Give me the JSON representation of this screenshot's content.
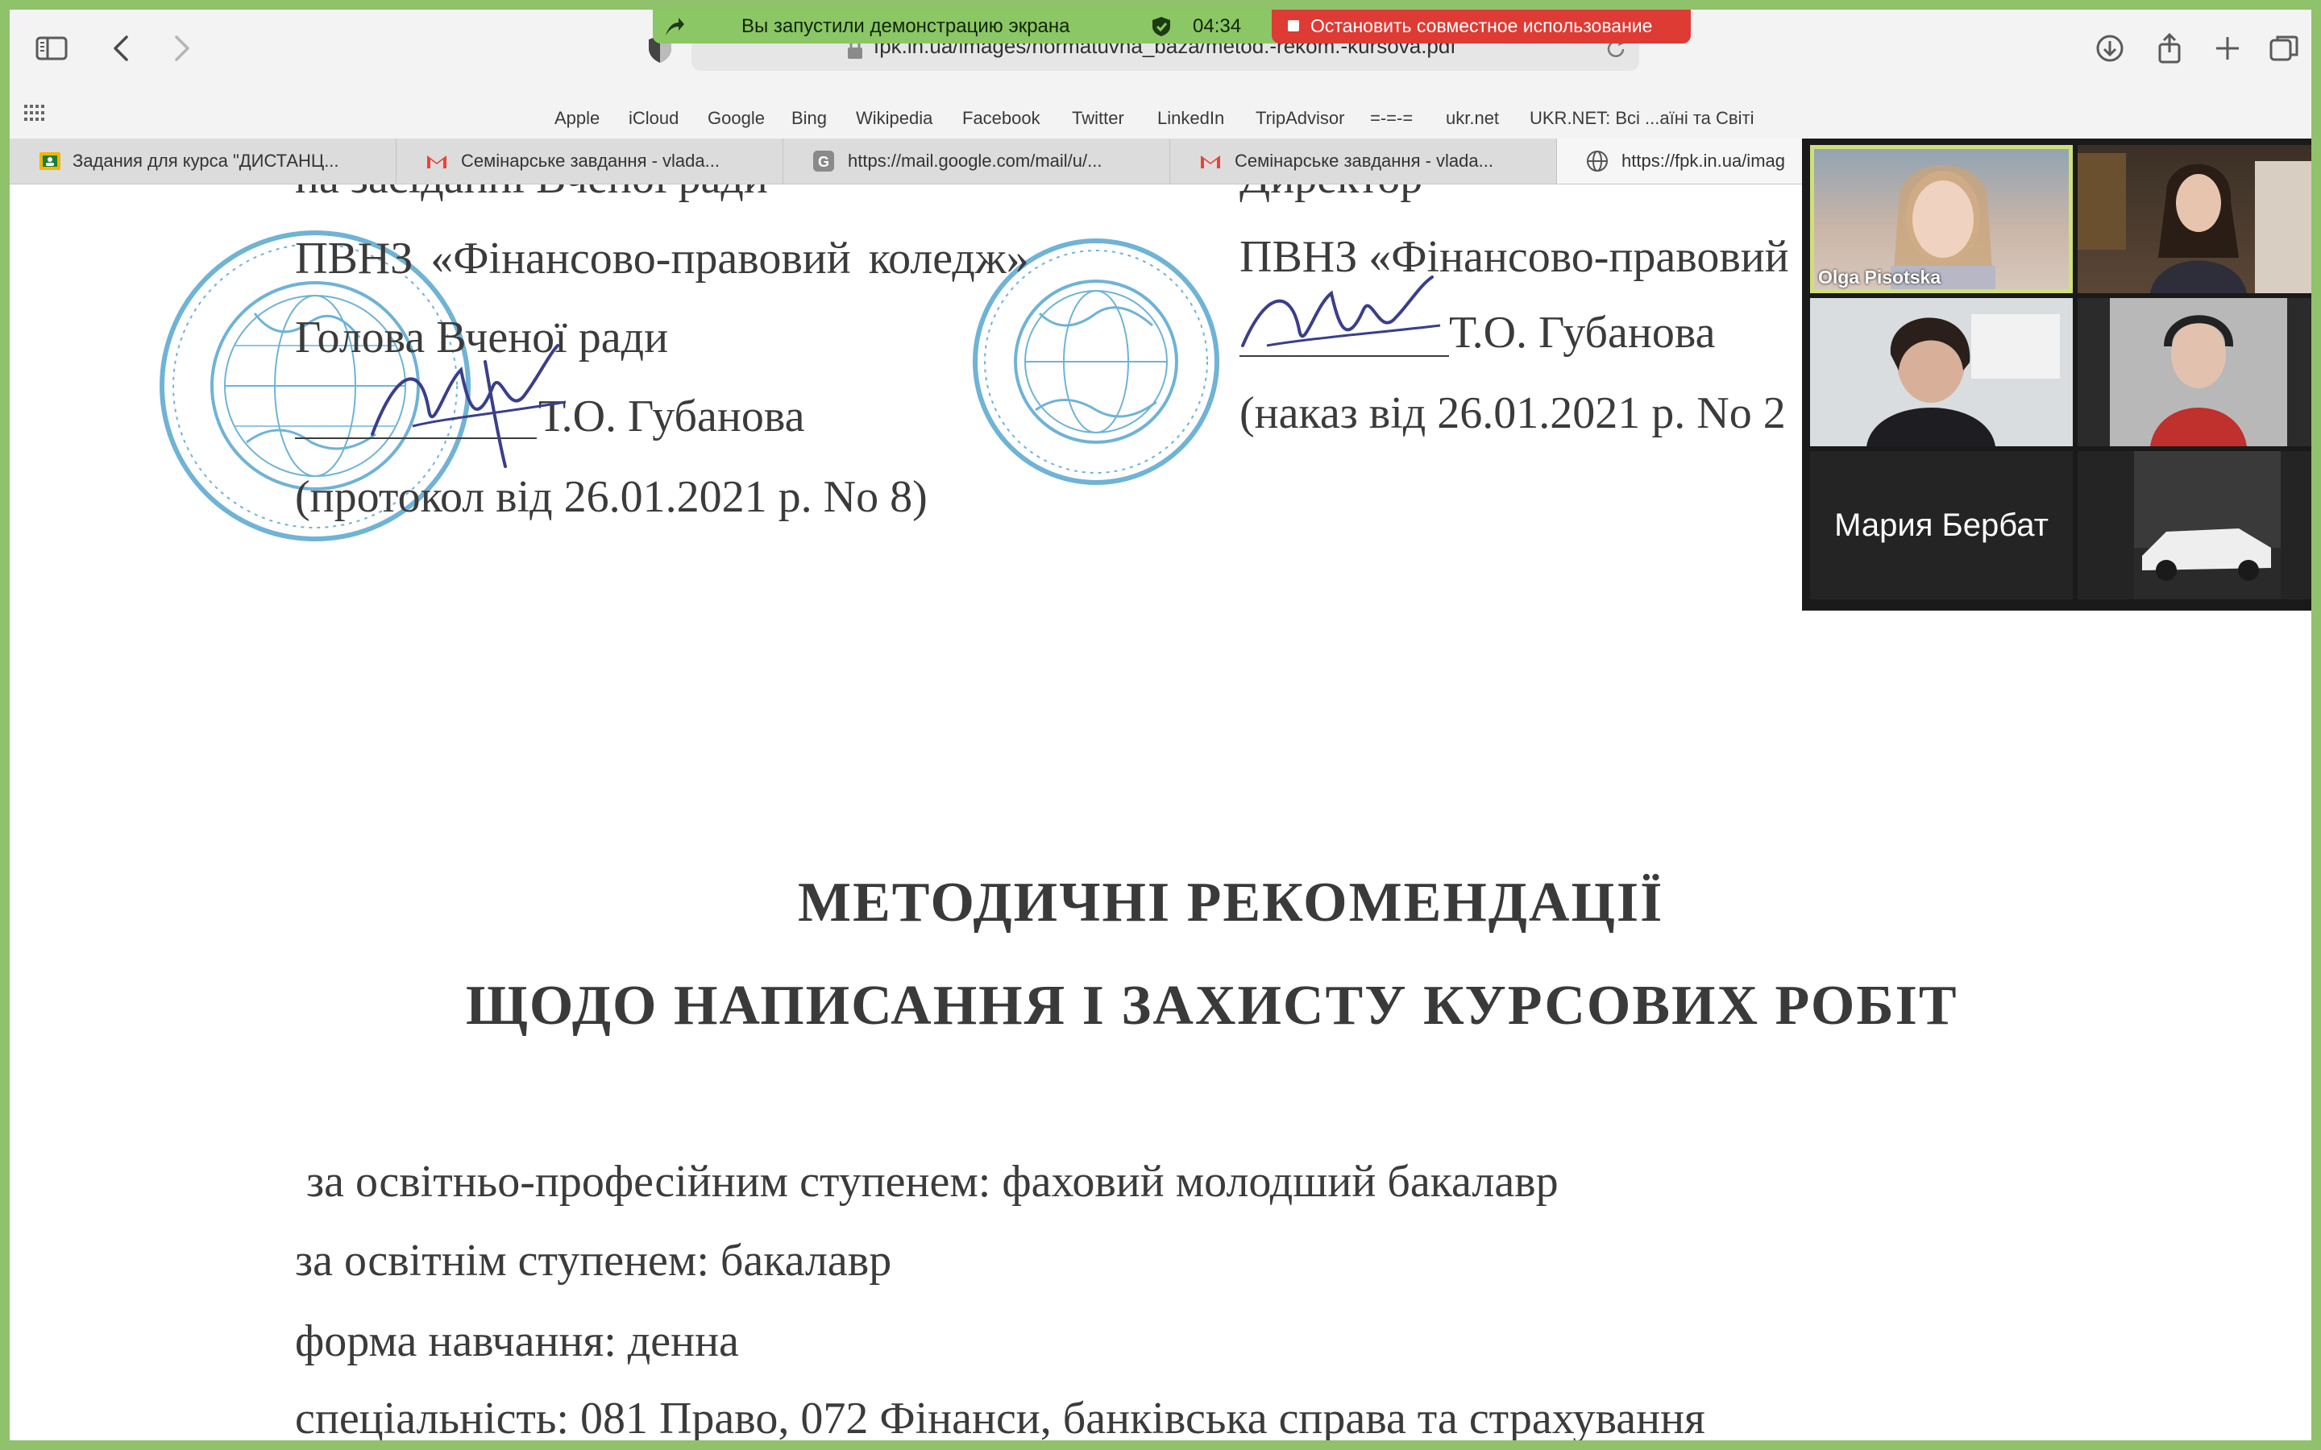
{
  "share_banner": {
    "text": "Вы запустили демонстрацию экрана",
    "timer": "04:34",
    "stop_label": "Остановить совместное использование"
  },
  "browser": {
    "url": "fpk.in.ua/images/normatuvna_baza/metod.-rekom.-kursova.pdf"
  },
  "favorites": [
    "Apple",
    "iCloud",
    "Google",
    "Bing",
    "Wikipedia",
    "Facebook",
    "Twitter",
    "LinkedIn",
    "TripAdvisor",
    "=-=-=",
    "ukr.net",
    "UKR.NET: Всі ...аїні та Світі"
  ],
  "tabs": [
    {
      "title": "Задания для курса \"ДИСТАНЦ...",
      "icon": "classroom-icon"
    },
    {
      "title": "Семінарське завдання - vlada...",
      "icon": "gmail-icon"
    },
    {
      "title": "https://mail.google.com/mail/u/...",
      "icon": "g-icon"
    },
    {
      "title": "Семінарське завдання - vlada...",
      "icon": "gmail-icon"
    },
    {
      "title": "https://fpk.in.ua/imag",
      "icon": "globe-icon"
    }
  ],
  "document": {
    "left_block": {
      "line0": "на засіданні Вченої ради",
      "line1": "ПВНЗ   «Фінансово-правовий   коледж»",
      "line2": "Голова Вченої ради",
      "line3": "Т.О. Губанова",
      "line4": "(протокол від 26.01.2021 р. No 8)"
    },
    "right_block": {
      "line0": "Директор",
      "line1": "ПВНЗ «Фінансово-правовий",
      "line2": "Т.О. Губанова",
      "line3": "(наказ від 26.01.2021 р. No 2"
    },
    "title1": "МЕТОДИЧНІ РЕКОМЕНДАЦІЇ",
    "title2": "ЩОДО НАПИСАННЯ І ЗАХИСТУ КУРСОВИХ РОБІТ",
    "details": [
      "за освітньо-професійним ступенем: фаховий молодший бакалавр",
      "за освітнім ступенем: бакалавр",
      "форма навчання: денна",
      "спеціальність: 081 Право, 072 Фінанси, банківська справа та страхування"
    ]
  },
  "video_call": {
    "participants": [
      {
        "name": "Olga Pisotska",
        "speaking": true
      },
      {
        "name": ""
      },
      {
        "name": ""
      },
      {
        "name": ""
      },
      {
        "name": "Мария Бербат"
      },
      {
        "name": ""
      }
    ]
  },
  "colors": {
    "share_green": "#8bc765",
    "stop_red": "#de3b34",
    "seal_blue": "#6fb3d6",
    "signature_ink": "#3a3f8a"
  }
}
